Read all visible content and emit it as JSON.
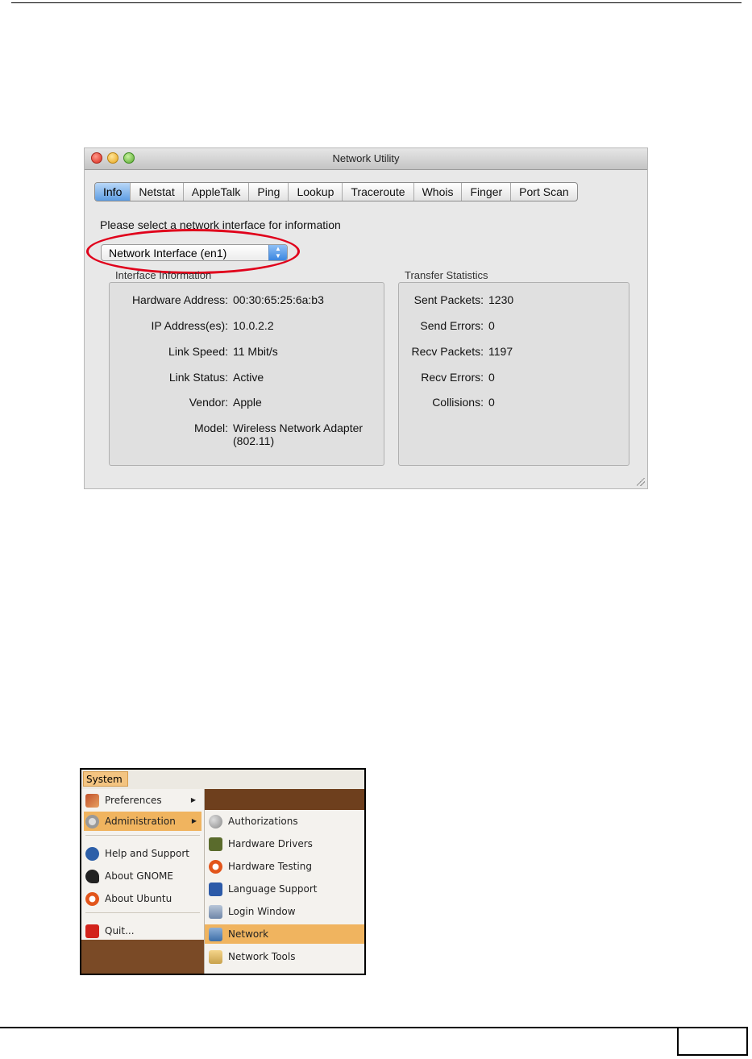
{
  "mac_window": {
    "title": "Network Utility",
    "tabs": [
      "Info",
      "Netstat",
      "AppleTalk",
      "Ping",
      "Lookup",
      "Traceroute",
      "Whois",
      "Finger",
      "Port Scan"
    ],
    "active_tab": "Info",
    "prompt": "Please select a network interface for information",
    "interface_select": "Network Interface (en1)",
    "interface_info": {
      "label": "Interface Information",
      "rows": [
        {
          "k": "Hardware Address:",
          "v": "00:30:65:25:6a:b3"
        },
        {
          "k": "IP Address(es):",
          "v": "10.0.2.2"
        },
        {
          "k": "Link Speed:",
          "v": "11 Mbit/s"
        },
        {
          "k": "Link Status:",
          "v": "Active"
        },
        {
          "k": "Vendor:",
          "v": "Apple"
        },
        {
          "k": "Model:",
          "v": "Wireless Network Adapter",
          "v2": "(802.11)"
        }
      ]
    },
    "transfer_stats": {
      "label": "Transfer Statistics",
      "rows": [
        {
          "k": "Sent Packets:",
          "v": "1230"
        },
        {
          "k": "Send Errors:",
          "v": "0"
        },
        {
          "k": "Recv Packets:",
          "v": "1197"
        },
        {
          "k": "Recv Errors:",
          "v": "0"
        },
        {
          "k": "Collisions:",
          "v": "0"
        }
      ]
    }
  },
  "ubuntu_menu": {
    "menubar": "System",
    "main_items": [
      "Preferences",
      "Administration",
      "Help and Support",
      "About GNOME",
      "About Ubuntu",
      "Quit..."
    ],
    "sub_items": [
      "Authorizations",
      "Hardware Drivers",
      "Hardware Testing",
      "Language Support",
      "Login Window",
      "Network",
      "Network Tools"
    ],
    "highlight_color": "#f0b45f"
  },
  "colors": {
    "highlight_ring": "#e0001b",
    "selected_tab": "#5e9de3"
  }
}
